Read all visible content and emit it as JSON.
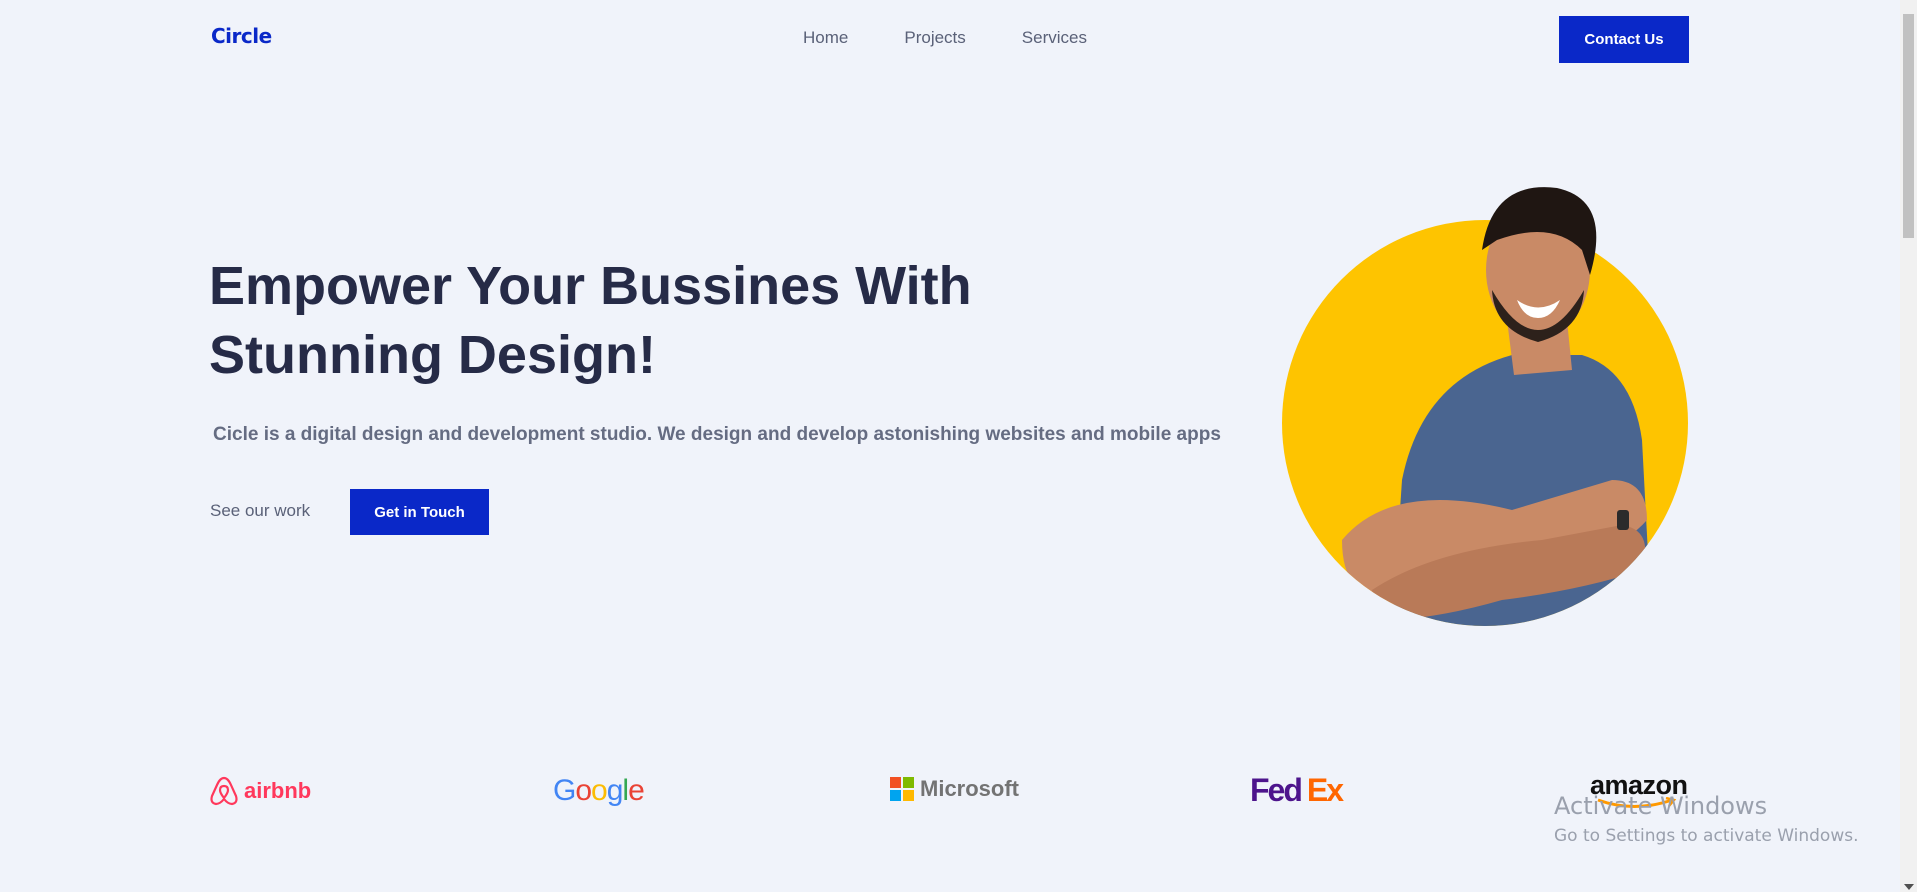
{
  "header": {
    "logo": "Circle",
    "nav": [
      "Home",
      "Projects",
      "Services"
    ],
    "contact_label": "Contact Us"
  },
  "hero": {
    "title": "Empower Your Bussines With Stunning Design!",
    "subtitle": "Cicle is a digital design and development studio. We design and develop astonishing websites and mobile apps",
    "see_work": "See our work",
    "cta": "Get in Touch",
    "image_alt": "smiling man with crossed arms",
    "accent_color": "#fec400"
  },
  "brand_color": "#0a28c8",
  "logos": {
    "airbnb": "airbnb",
    "google": [
      "G",
      "o",
      "o",
      "g",
      "l",
      "e"
    ],
    "microsoft": "Microsoft",
    "fedex_fed": "Fed",
    "fedex_ex": "Ex",
    "amazon": "amazon"
  },
  "watermark": {
    "title": "Activate Windows",
    "subtitle": "Go to Settings to activate Windows."
  }
}
